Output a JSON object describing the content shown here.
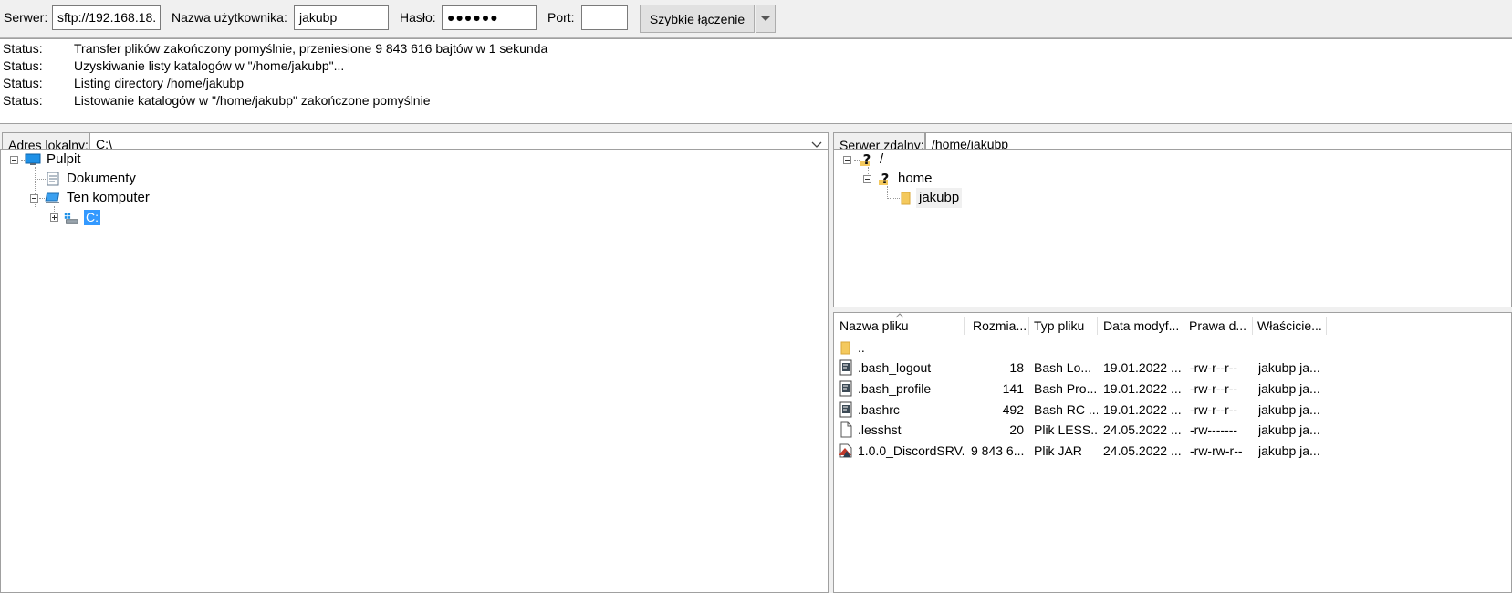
{
  "quickconnect": {
    "host_label": "Serwer:",
    "host_value": "sftp://192.168.18.",
    "user_label": "Nazwa użytkownika:",
    "user_value": "jakubp",
    "pass_label": "Hasło:",
    "pass_value": "●●●●●●",
    "port_label": "Port:",
    "port_value": "",
    "connect_label": "Szybkie łączenie"
  },
  "log": [
    {
      "type": "Status:",
      "text": "Transfer plików zakończony pomyślnie, przeniesione 9 843 616 bajtów w 1 sekunda"
    },
    {
      "type": "Status:",
      "text": "Uzyskiwanie listy katalogów w \"/home/jakubp\"..."
    },
    {
      "type": "Status:",
      "text": "Listing directory /home/jakubp"
    },
    {
      "type": "Status:",
      "text": "Listowanie katalogów w \"/home/jakubp\" zakończone pomyślnie"
    }
  ],
  "local": {
    "label": "Adres lokalny:",
    "path": "C:\\",
    "tree": {
      "desktop": "Pulpit",
      "documents": "Dokumenty",
      "computer": "Ten komputer",
      "drive_c": "C:"
    }
  },
  "remote": {
    "label": "Serwer zdalny:",
    "path": "/home/jakubp",
    "tree": {
      "root": "/",
      "home": "home",
      "user": "jakubp"
    },
    "columns": [
      "Nazwa pliku",
      "Rozmia...",
      "Typ pliku",
      "Data modyf...",
      "Prawa d...",
      "Właścicie..."
    ],
    "files": [
      {
        "name": "..",
        "size": "",
        "type": "",
        "date": "",
        "perms": "",
        "owner": "",
        "icon": "folder-icon"
      },
      {
        "name": ".bash_logout",
        "size": "18",
        "type": "Bash Lo...",
        "date": "19.01.2022 ...",
        "perms": "-rw-r--r--",
        "owner": "jakubp ja...",
        "icon": "script-file-icon"
      },
      {
        "name": ".bash_profile",
        "size": "141",
        "type": "Bash Pro...",
        "date": "19.01.2022 ...",
        "perms": "-rw-r--r--",
        "owner": "jakubp ja...",
        "icon": "script-file-icon"
      },
      {
        "name": ".bashrc",
        "size": "492",
        "type": "Bash RC ...",
        "date": "19.01.2022 ...",
        "perms": "-rw-r--r--",
        "owner": "jakubp ja...",
        "icon": "script-file-icon"
      },
      {
        "name": ".lesshst",
        "size": "20",
        "type": "Plik LESS...",
        "date": "24.05.2022 ...",
        "perms": "-rw-------",
        "owner": "jakubp ja...",
        "icon": "blank-file-icon"
      },
      {
        "name": "1.0.0_DiscordSRV...",
        "size": "9 843 6...",
        "type": "Plik JAR",
        "date": "24.05.2022 ...",
        "perms": "-rw-rw-r--",
        "owner": "jakubp ja...",
        "icon": "jar-file-icon"
      }
    ]
  }
}
